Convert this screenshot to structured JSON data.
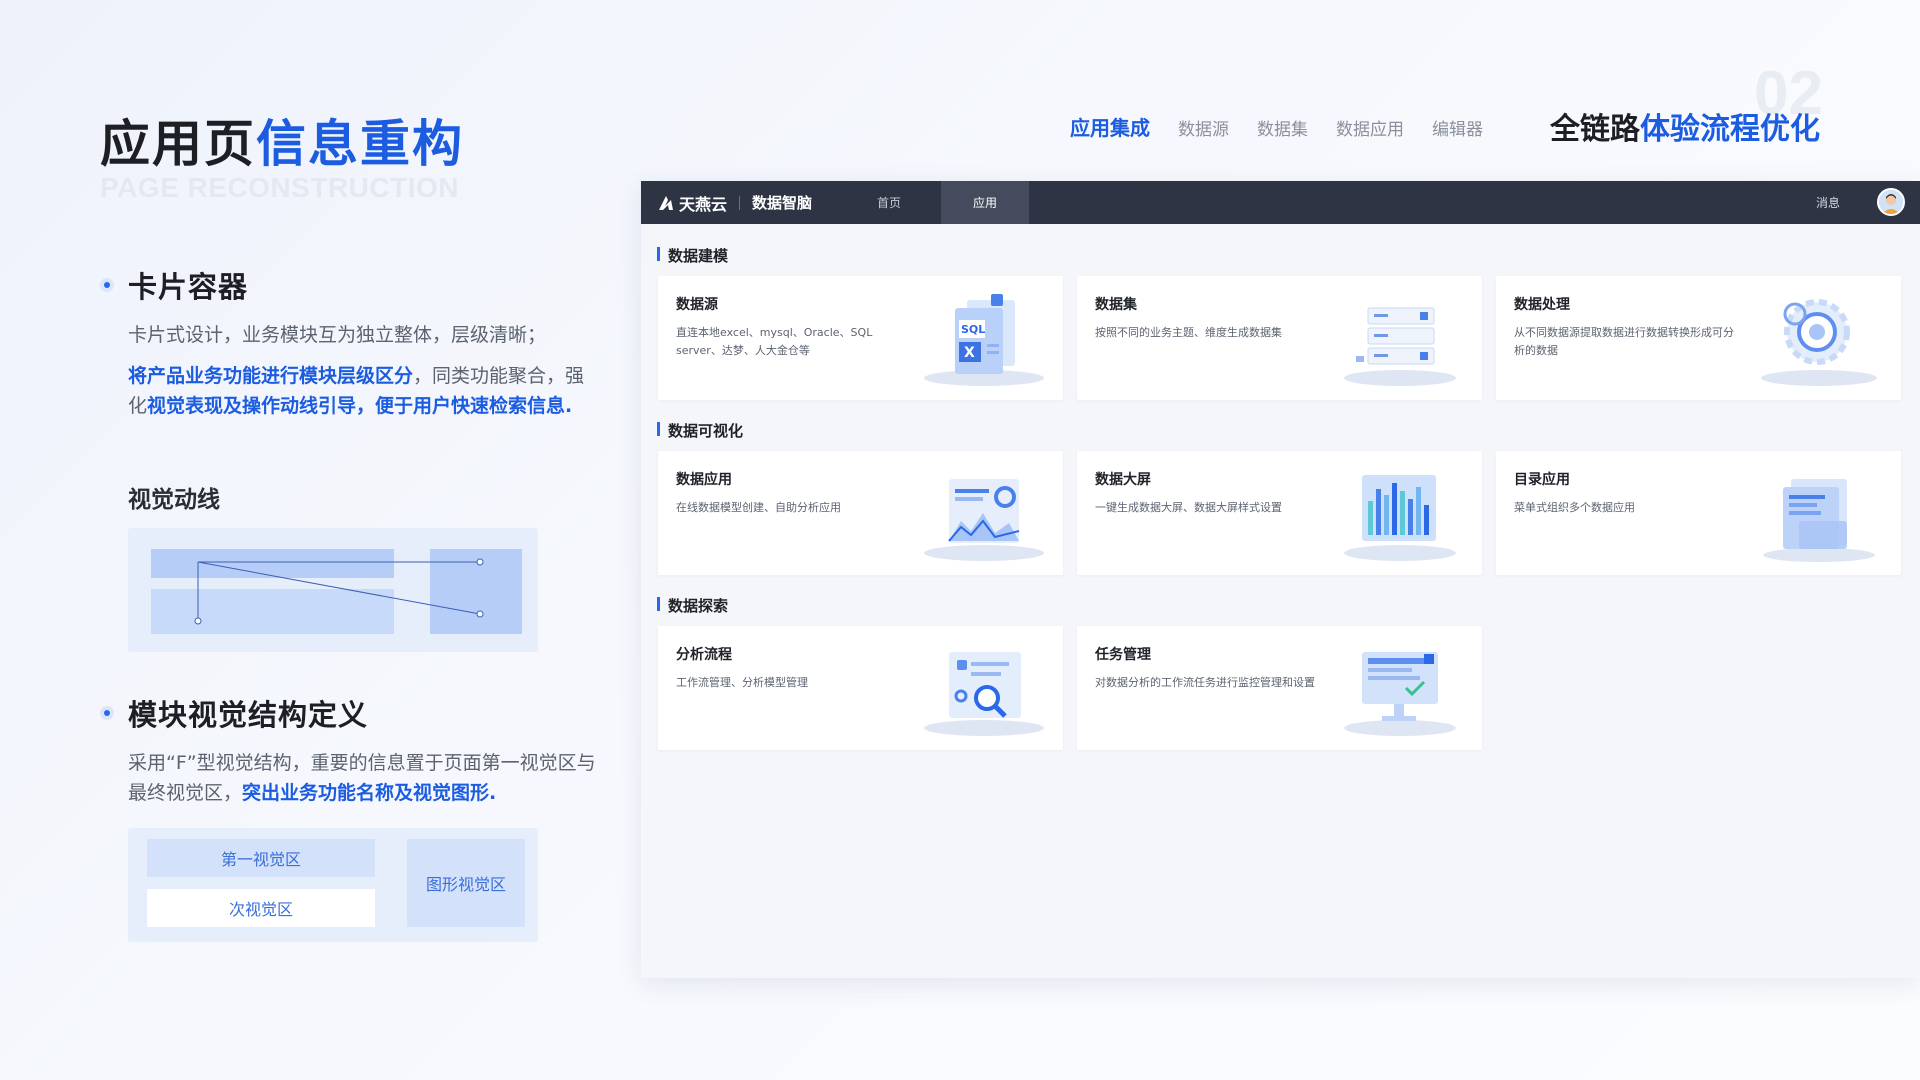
{
  "header": {
    "title_main": "应用页",
    "title_highlight": "信息重构",
    "subtitle_en": "PAGE RECONSTRUCTION"
  },
  "sections": [
    {
      "title": "卡片容器",
      "line1": "卡片式设计，业务模块互为独立整体，层级清晰；",
      "hl1": "将产品业务功能进行模块层级区分",
      "mid1": "，同类功能聚合，强化",
      "hl2": "视觉表现及操作动线引导，便于用户快速检索信息.",
      "sub_title": "视觉动线"
    },
    {
      "title": "模块视觉结构定义",
      "text": "采用“F”型视觉结构，重要的信息置于页面第一视觉区与最终视觉区，",
      "hl": "突出业务功能名称及视觉图形.",
      "zones": {
        "first": "第一视觉区",
        "second": "次视觉区",
        "graphic": "图形视觉区"
      }
    }
  ],
  "top_nav": {
    "tabs": [
      "应用集成",
      "数据源",
      "数据集",
      "数据应用",
      "编辑器"
    ],
    "active_index": 0
  },
  "flow": {
    "number": "02",
    "title_main": "全链路",
    "title_highlight": "体验流程优化"
  },
  "app": {
    "logo_text": "天燕云",
    "product": "数据智脑",
    "nav": [
      "首页",
      "应用"
    ],
    "active_nav": "应用",
    "message": "消息",
    "groups": [
      {
        "title": "数据建模",
        "cards": [
          {
            "title": "数据源",
            "desc": "直连本地excel、mysql、Oracle、SQL server、达梦、人大金仓等",
            "icon": "database-doc-icon"
          },
          {
            "title": "数据集",
            "desc": "按照不同的业务主题、维度生成数据集",
            "icon": "server-stack-icon"
          },
          {
            "title": "数据处理",
            "desc": "从不同数据源提取数据进行数据转换形成可分析的数据",
            "icon": "gear-process-icon"
          }
        ]
      },
      {
        "title": "数据可视化",
        "cards": [
          {
            "title": "数据应用",
            "desc": "在线数据模型创建、自助分析应用",
            "icon": "chart-report-icon"
          },
          {
            "title": "数据大屏",
            "desc": "一键生成数据大屏、数据大屏样式设置",
            "icon": "big-screen-icon"
          },
          {
            "title": "目录应用",
            "desc": "菜单式组织多个数据应用",
            "icon": "catalog-folder-icon"
          }
        ]
      },
      {
        "title": "数据探索",
        "cards": [
          {
            "title": "分析流程",
            "desc": "工作流管理、分析模型管理",
            "icon": "magnifier-doc-icon"
          },
          {
            "title": "任务管理",
            "desc": "对数据分析的工作流任务进行监控管理和设置",
            "icon": "task-monitor-icon"
          }
        ]
      }
    ]
  },
  "colors": {
    "accent": "#1b5ce0",
    "appbar": "#2f3444",
    "card_bg": "#ffffff"
  }
}
